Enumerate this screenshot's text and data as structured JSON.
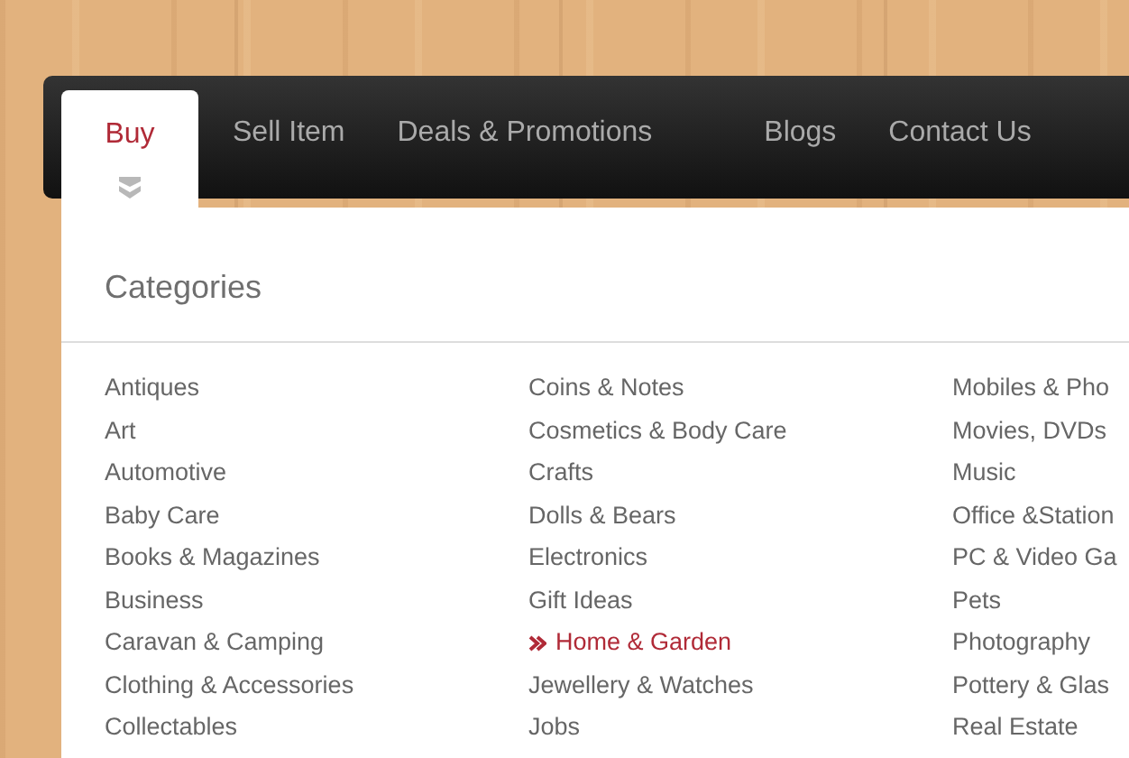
{
  "nav": {
    "tabs": [
      {
        "label": "Buy",
        "selected": true
      },
      {
        "label": "Sell Item",
        "selected": false
      },
      {
        "label": "Deals & Promotions",
        "selected": false
      },
      {
        "label": "Blogs",
        "selected": false
      },
      {
        "label": "Contact Us",
        "selected": false
      }
    ]
  },
  "categories": {
    "title": "Categories",
    "columns": [
      [
        {
          "label": "Antiques",
          "selected": false
        },
        {
          "label": "Art",
          "selected": false
        },
        {
          "label": "Automotive",
          "selected": false
        },
        {
          "label": "Baby Care",
          "selected": false
        },
        {
          "label": "Books & Magazines",
          "selected": false
        },
        {
          "label": "Business",
          "selected": false
        },
        {
          "label": "Caravan & Camping",
          "selected": false
        },
        {
          "label": "Clothing & Accessories",
          "selected": false
        },
        {
          "label": "Collectables",
          "selected": false
        }
      ],
      [
        {
          "label": "Coins & Notes",
          "selected": false
        },
        {
          "label": "Cosmetics & Body Care",
          "selected": false
        },
        {
          "label": "Crafts",
          "selected": false
        },
        {
          "label": "Dolls & Bears",
          "selected": false
        },
        {
          "label": "Electronics",
          "selected": false
        },
        {
          "label": "Gift Ideas",
          "selected": false
        },
        {
          "label": "Home & Garden",
          "selected": true
        },
        {
          "label": "Jewellery & Watches",
          "selected": false
        },
        {
          "label": "Jobs",
          "selected": false
        }
      ],
      [
        {
          "label": "Mobiles & Pho",
          "selected": false
        },
        {
          "label": "Movies, DVDs",
          "selected": false
        },
        {
          "label": "Music",
          "selected": false
        },
        {
          "label": "Office &Station",
          "selected": false
        },
        {
          "label": "PC & Video Ga",
          "selected": false
        },
        {
          "label": "Pets",
          "selected": false
        },
        {
          "label": "Photography",
          "selected": false
        },
        {
          "label": "Pottery & Glas",
          "selected": false
        },
        {
          "label": "Real Estate",
          "selected": false
        }
      ]
    ]
  }
}
